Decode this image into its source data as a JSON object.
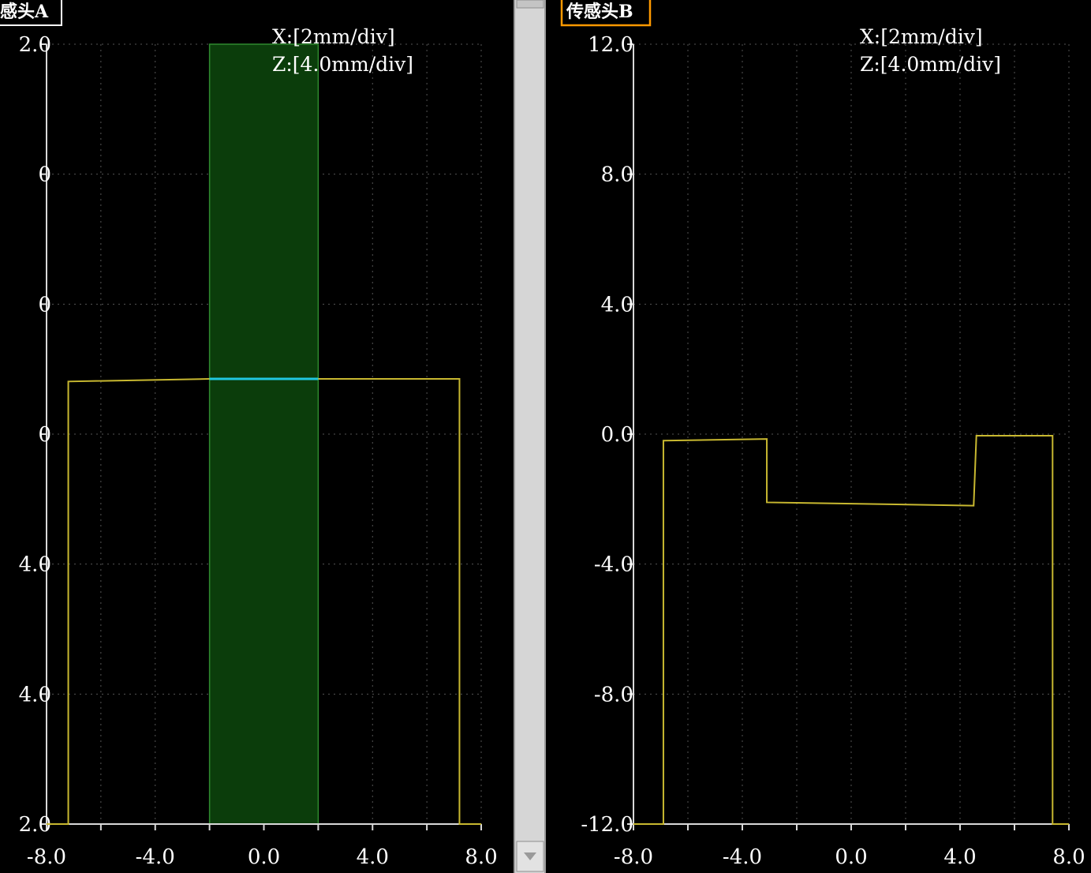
{
  "colors": {
    "background": "#000000",
    "axis": "#d8d8d8",
    "grid": "#555555",
    "trace": "#c8b830",
    "noise": "#e03020",
    "highlight_fill": "#0b3d0b",
    "highlight_edge": "#2f8a2f",
    "highlight_segment": "#20c8e0",
    "scrollbar": "#d6d6d6",
    "label_box_a": "#ffffff",
    "label_box_b": "#ff9900"
  },
  "scrollbar": {
    "arrow_icon": "triangle-down"
  },
  "panels": [
    {
      "id": "a",
      "title": "感头A",
      "scale_x": "X:[2mm/div]",
      "scale_z": "Z:[4.0mm/div]",
      "y_tick_labels": [
        "2.0",
        "0",
        "0",
        "0",
        "4.0",
        "4.0",
        "2.0"
      ],
      "x_tick_labels": [
        "-8.0",
        "-4.0",
        "0.0",
        "4.0",
        "8.0"
      ]
    },
    {
      "id": "b",
      "title": "传感头B",
      "scale_x": "X:[2mm/div]",
      "scale_z": "Z:[4.0mm/div]",
      "y_tick_labels": [
        "12.0",
        "8.0",
        "4.0",
        "0.0",
        "-4.0",
        "-8.0",
        "-12.0"
      ],
      "x_tick_labels": [
        "-8.0",
        "-4.0",
        "0.0",
        "4.0",
        "8.0"
      ]
    }
  ],
  "chart_data": [
    {
      "type": "line",
      "panel": "a",
      "xlim": [
        -8,
        8
      ],
      "ylim": [
        -12,
        12
      ],
      "grid": true,
      "highlight_band": {
        "x": [
          -2.0,
          2.0
        ]
      },
      "highlight_segment": {
        "x": [
          -2.0,
          2.0
        ],
        "y": 1.7
      },
      "series": [
        {
          "x": [
            -8.0,
            -7.2,
            -7.2,
            -2.0,
            2.0,
            7.2,
            7.2,
            8.0
          ],
          "y": [
            -12.0,
            -12.0,
            1.62,
            1.7,
            1.7,
            1.7,
            -12.0,
            -12.0
          ]
        }
      ]
    },
    {
      "type": "line",
      "panel": "b",
      "xlim": [
        -8,
        8
      ],
      "ylim": [
        -12,
        12
      ],
      "grid": true,
      "series": [
        {
          "x": [
            -8.0,
            -6.9,
            -6.9,
            -3.1,
            -3.1,
            4.5,
            4.6,
            7.4,
            7.4,
            8.0
          ],
          "y": [
            -12.0,
            -12.0,
            -0.2,
            -0.15,
            -2.1,
            -2.2,
            -0.05,
            -0.05,
            -12.0,
            -12.0
          ]
        }
      ]
    }
  ]
}
